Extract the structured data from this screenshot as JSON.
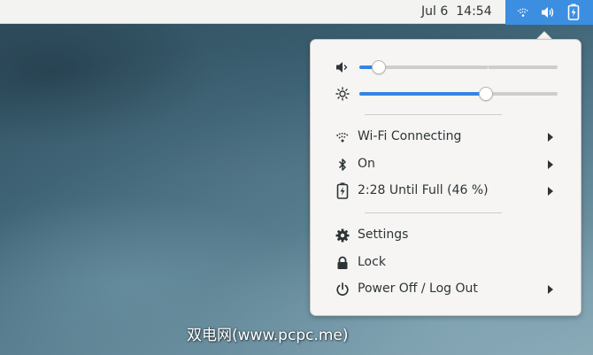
{
  "topbar": {
    "date": "Jul 6",
    "time": "14:54",
    "status_icons": [
      "wifi-connecting-icon",
      "volume-icon",
      "battery-charging-icon"
    ],
    "status_area_color": "#3c8ee0"
  },
  "menu": {
    "volume": {
      "icon": "volume-muted-icon",
      "level": 0.1
    },
    "brightness": {
      "icon": "brightness-icon",
      "level": 0.64
    },
    "items": [
      {
        "icon": "wifi-connecting-icon",
        "label": "Wi-Fi Connecting",
        "submenu": true
      },
      {
        "icon": "bluetooth-icon",
        "label": "On",
        "submenu": true
      },
      {
        "icon": "battery-charging-icon",
        "label": "2:28 Until Full (46 %)",
        "submenu": true
      },
      {
        "icon": "gear-icon",
        "label": "Settings",
        "submenu": false
      },
      {
        "icon": "lock-icon",
        "label": "Lock",
        "submenu": false
      },
      {
        "icon": "power-icon",
        "label": "Power Off / Log Out",
        "submenu": true
      }
    ],
    "accent_color": "#3584e4"
  },
  "watermark": "双电网(www.pcpc.me)"
}
